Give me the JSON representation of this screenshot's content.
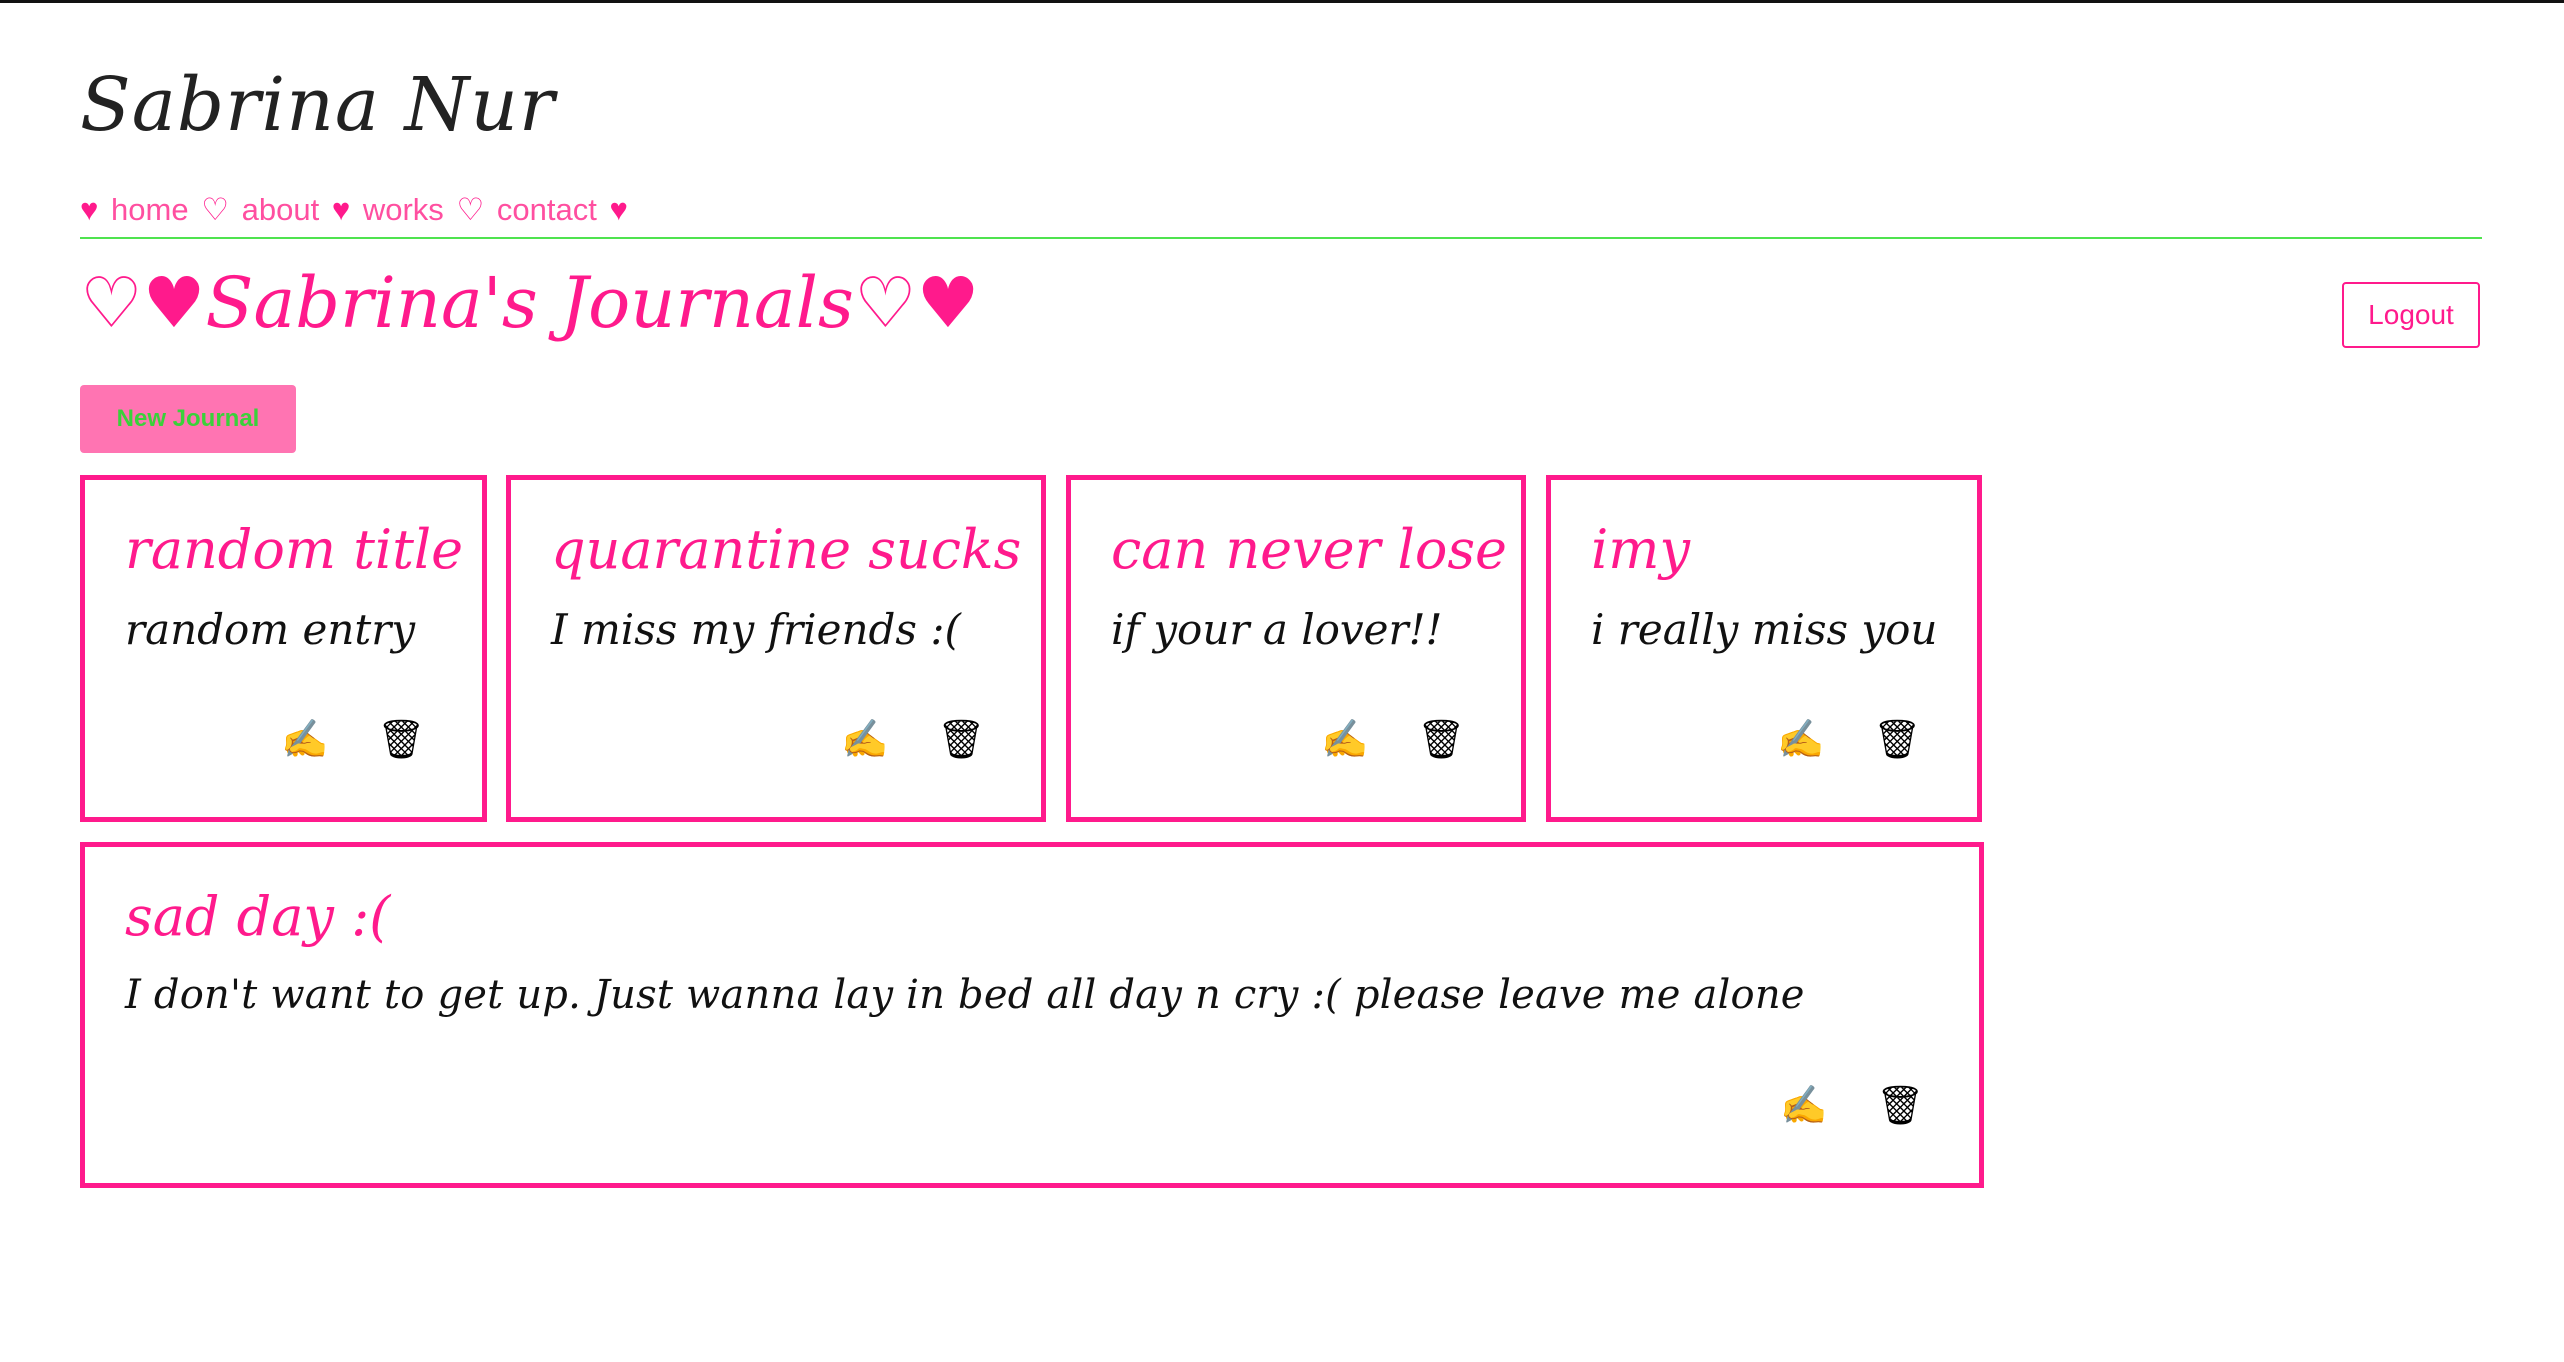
{
  "site": {
    "title": "Sabrina Nur"
  },
  "nav": {
    "items": [
      {
        "label": "home"
      },
      {
        "label": "about"
      },
      {
        "label": "works"
      },
      {
        "label": "contact"
      }
    ],
    "separators": [
      "♥",
      "♡",
      "♥",
      "♡",
      "♥"
    ]
  },
  "page": {
    "heading": "♡♥Sabrina's Journals♡♥"
  },
  "toolbar": {
    "logout_label": "Logout",
    "new_journal_label": "New Journal"
  },
  "journals": [
    {
      "title": "random title",
      "entry": "random entry",
      "edit_icon": "✍",
      "delete_icon": "🗑"
    },
    {
      "title": "quarantine sucks",
      "entry": "I miss my friends :(",
      "edit_icon": "✍",
      "delete_icon": "🗑"
    },
    {
      "title": "can never lose",
      "entry": "if your a lover!!",
      "edit_icon": "✍",
      "delete_icon": "🗑"
    },
    {
      "title": "imy",
      "entry": "i really miss you",
      "edit_icon": "✍",
      "delete_icon": "🗑"
    },
    {
      "title": "sad day :(",
      "entry": "I don't want to get up. Just wanna lay in bed all day n cry :( please leave me alone",
      "edit_icon": "✍",
      "delete_icon": "🗑"
    }
  ],
  "colors": {
    "accent": "#ff1a8c",
    "button_bg": "#ff74b2",
    "rule": "#4fe34f"
  }
}
